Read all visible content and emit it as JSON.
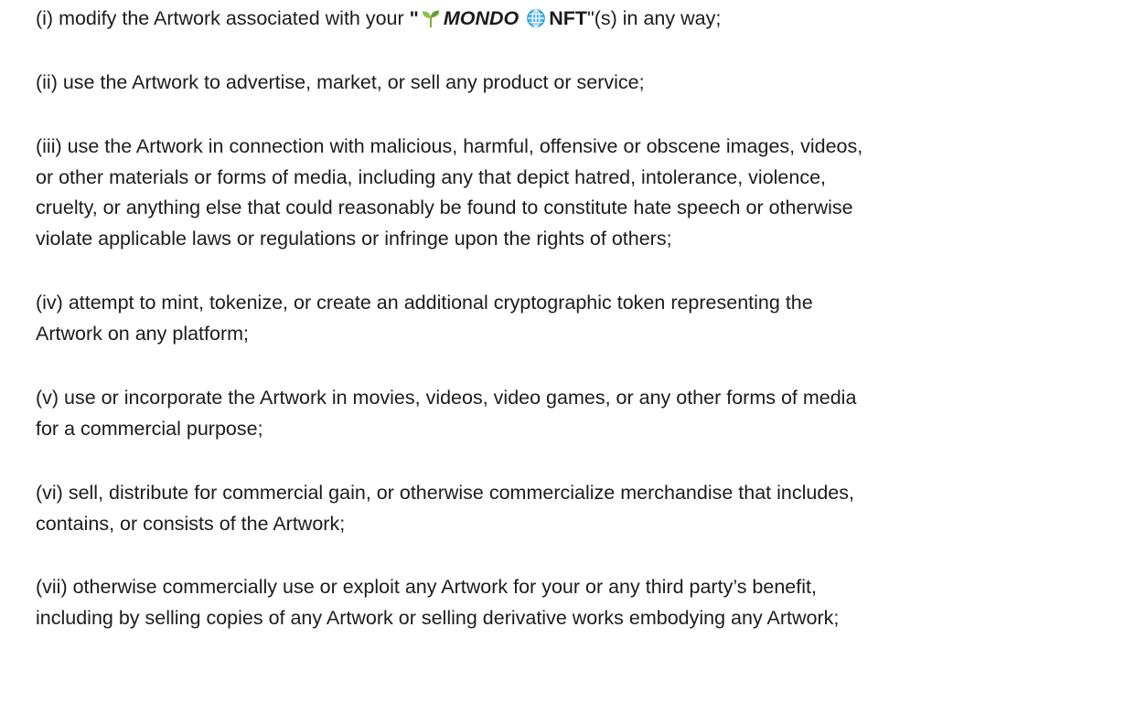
{
  "document": {
    "paragraphs": [
      {
        "id": "i",
        "intro": "(i) modify the Artwork associated with your ",
        "open_quote": "\"",
        "brand": "MONDO",
        "nft": "NFT",
        "close": "\"(s) in any way;"
      },
      {
        "id": "ii",
        "lines": [
          "(ii) use the Artwork to advertise, market, or sell any product or service;"
        ]
      },
      {
        "id": "iii",
        "lines": [
          "(iii) use the Artwork in connection with malicious, harmful, offensive or obscene images, videos,",
          "or other materials or forms of media, including any that depict hatred, intolerance, violence,",
          "cruelty, or anything else that could reasonably be found to constitute hate speech or otherwise",
          "violate applicable laws or regulations or infringe upon the rights of others;"
        ]
      },
      {
        "id": "iv",
        "lines": [
          "(iv) attempt to mint, tokenize, or create an additional cryptographic token representing the",
          "Artwork on any platform;"
        ]
      },
      {
        "id": "v",
        "lines": [
          "(v) use or incorporate the Artwork in movies, videos, video games, or any other forms of media",
          "for a commercial purpose;"
        ]
      },
      {
        "id": "vi",
        "lines": [
          "(vi) sell, distribute for commercial gain, or otherwise commercialize merchandise that includes,",
          "contains, or consists of the Artwork;"
        ]
      },
      {
        "id": "vii",
        "lines": [
          "(vii) otherwise commercially use or exploit any Artwork for your or any third party’s benefit,",
          "including by selling copies of any Artwork or selling derivative works embodying any Artwork;"
        ]
      }
    ],
    "icons": {
      "seedling": "seedling-icon",
      "globe": "globe-icon"
    },
    "colors": {
      "text": "#1c1c1c",
      "seedling": "#7cb342",
      "globe": "#2e9bd6"
    }
  }
}
